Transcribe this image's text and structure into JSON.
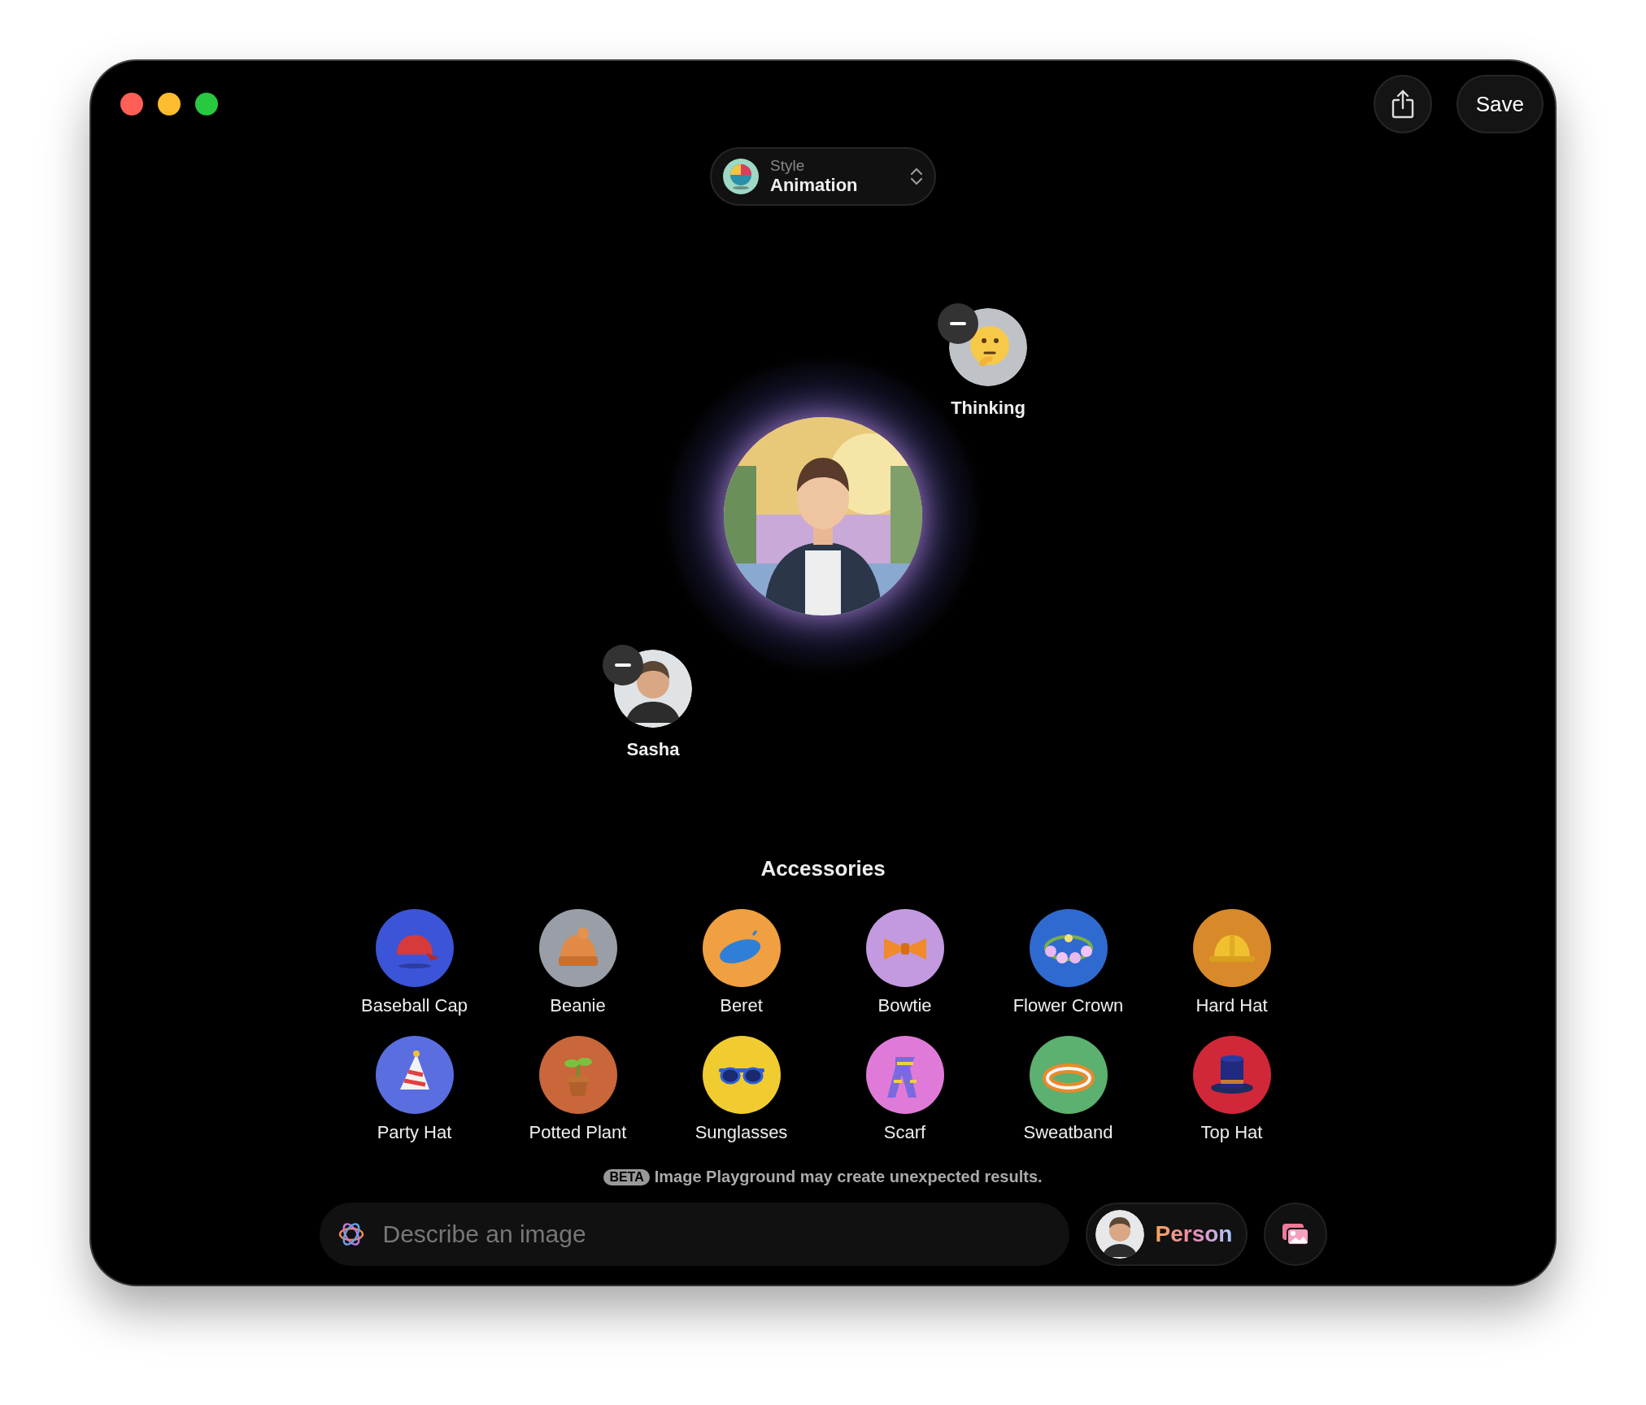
{
  "toolbar": {
    "save": "Save"
  },
  "style_picker": {
    "label": "Style",
    "value": "Animation"
  },
  "concepts": [
    {
      "label": "Thinking",
      "kind": "emoji"
    },
    {
      "label": "Sasha",
      "kind": "person"
    }
  ],
  "accessories": {
    "title": "Accessories",
    "items": [
      {
        "label": "Baseball Cap"
      },
      {
        "label": "Beanie"
      },
      {
        "label": "Beret"
      },
      {
        "label": "Bowtie"
      },
      {
        "label": "Flower Crown"
      },
      {
        "label": "Hard Hat"
      },
      {
        "label": "Party Hat"
      },
      {
        "label": "Potted Plant"
      },
      {
        "label": "Sunglasses"
      },
      {
        "label": "Scarf"
      },
      {
        "label": "Sweatband"
      },
      {
        "label": "Top Hat"
      }
    ]
  },
  "notice": {
    "badge": "BETA",
    "text": "Image Playground may create unexpected results."
  },
  "prompt": {
    "placeholder": "Describe an image"
  },
  "person_button": {
    "label": "Person"
  }
}
